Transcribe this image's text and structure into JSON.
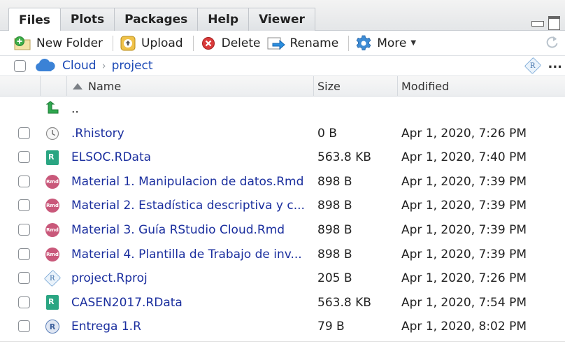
{
  "tabs": [
    {
      "label": "Files",
      "active": true
    },
    {
      "label": "Plots",
      "active": false
    },
    {
      "label": "Packages",
      "active": false
    },
    {
      "label": "Help",
      "active": false
    },
    {
      "label": "Viewer",
      "active": false
    }
  ],
  "toolbar": {
    "new_folder": "New Folder",
    "upload": "Upload",
    "delete": "Delete",
    "rename": "Rename",
    "more": "More"
  },
  "breadcrumb": {
    "root": "Cloud",
    "current": "project",
    "ellipsis": "..."
  },
  "table": {
    "headers": {
      "name": "Name",
      "size": "Size",
      "modified": "Modified"
    },
    "parent_label": "..",
    "files": [
      {
        "name": ".Rhistory",
        "size": "0 B",
        "modified": "Apr 1, 2020, 7:26 PM",
        "icon": "history-icon"
      },
      {
        "name": "ELSOC.RData",
        "size": "563.8 KB",
        "modified": "Apr 1, 2020, 7:40 PM",
        "icon": "rdata-icon"
      },
      {
        "name": "Material 1. Manipulacion de datos.Rmd",
        "size": "898 B",
        "modified": "Apr 1, 2020, 7:39 PM",
        "icon": "rmd-icon"
      },
      {
        "name": "Material 2. Estadística descriptiva y c...",
        "size": "898 B",
        "modified": "Apr 1, 2020, 7:39 PM",
        "icon": "rmd-icon"
      },
      {
        "name": "Material 3. Guía RStudio Cloud.Rmd",
        "size": "898 B",
        "modified": "Apr 1, 2020, 7:39 PM",
        "icon": "rmd-icon"
      },
      {
        "name": "Material 4. Plantilla de Trabajo de inv...",
        "size": "898 B",
        "modified": "Apr 1, 2020, 7:39 PM",
        "icon": "rmd-icon"
      },
      {
        "name": "project.Rproj",
        "size": "205 B",
        "modified": "Apr 1, 2020, 7:26 PM",
        "icon": "rproj-icon"
      },
      {
        "name": "CASEN2017.RData",
        "size": "563.8 KB",
        "modified": "Apr 1, 2020, 7:54 PM",
        "icon": "rdata-icon"
      },
      {
        "name": "Entrega 1.R",
        "size": "79 B",
        "modified": "Apr 1, 2020, 8:02 PM",
        "icon": "r-script-icon"
      }
    ]
  },
  "colors": {
    "link": "#1a2e9e",
    "crumb_link": "#1a48b5",
    "rmd_icon": "#c9587a",
    "rdata_icon": "#2aa582",
    "cloud_icon": "#3b82d6"
  }
}
